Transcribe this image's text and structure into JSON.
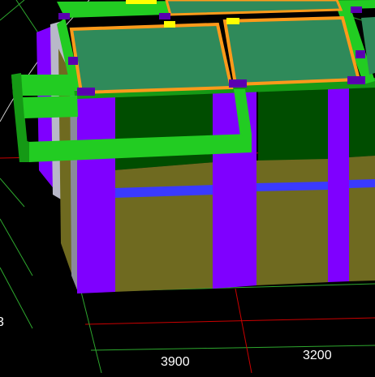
{
  "viewport": {
    "background": "#000000",
    "palette": {
      "column": "#7f00ff",
      "column_dark": "#5a00b0",
      "wall": "#6f6a20",
      "beam_green": "#22cc22",
      "beam_green_dark": "#159915",
      "slab": "#2f8a5a",
      "slab_border": "#ff9a1a",
      "marker": "#ffff00",
      "blue_beam": "#3a3aff",
      "grid_red": "#cc0000",
      "grid_green": "#2ea82e",
      "dark_green_fill": "#004d00"
    }
  },
  "dimensions": {
    "label_1": "3900",
    "label_2": "3200",
    "label_edge": "3"
  }
}
